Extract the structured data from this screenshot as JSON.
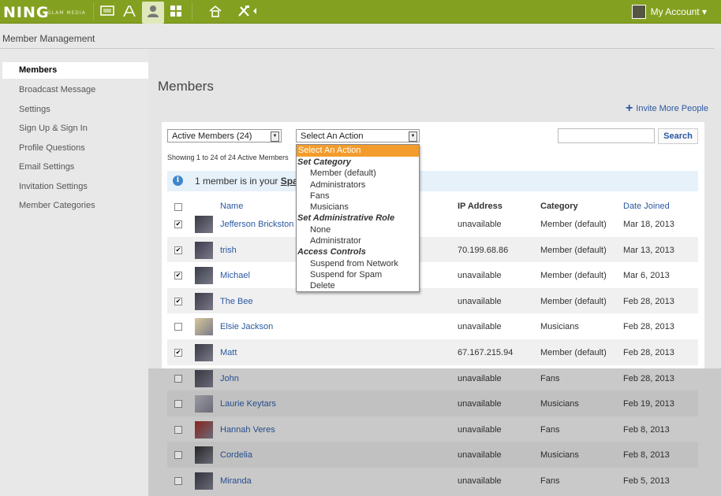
{
  "topbar": {
    "logo": "NING",
    "logo_sub": "GLAM MEDIA",
    "account_label": "My Account ▾"
  },
  "subheader": {
    "title": "Member Management"
  },
  "sidebar": {
    "items": [
      {
        "label": "Members"
      },
      {
        "label": "Broadcast Message"
      },
      {
        "label": "Settings"
      },
      {
        "label": "Sign Up & Sign In"
      },
      {
        "label": "Profile Questions"
      },
      {
        "label": "Email Settings"
      },
      {
        "label": "Invitation Settings"
      },
      {
        "label": "Member Categories"
      }
    ]
  },
  "main": {
    "title": "Members",
    "invite_label": "Invite More People",
    "filter_select": "Active Members (24)",
    "action_select": "Select An Action",
    "search_button": "Search",
    "showing": "Showing 1 to 24 of 24 Active Members",
    "info_text": "1 member is in your ",
    "info_link": "Spa"
  },
  "table": {
    "headers": {
      "name": "Name",
      "ip": "IP Address",
      "category": "Category",
      "date": "Date Joined"
    },
    "rows": [
      {
        "name": "Jefferson Brickston",
        "ip": "unavailable",
        "category": "Member (default)",
        "date": "Mar 18, 2013",
        "checked": true
      },
      {
        "name": "trish",
        "ip": "70.199.68.86",
        "category": "Member (default)",
        "date": "Mar 13, 2013",
        "checked": true
      },
      {
        "name": "Michael",
        "ip": "unavailable",
        "category": "Member (default)",
        "date": "Mar 6, 2013",
        "checked": true
      },
      {
        "name": "The Bee",
        "ip": "unavailable",
        "category": "Member (default)",
        "date": "Feb 28, 2013",
        "checked": true
      },
      {
        "name": "Elsie Jackson",
        "ip": "unavailable",
        "category": "Musicians",
        "date": "Feb 28, 2013",
        "checked": false
      },
      {
        "name": "Matt",
        "ip": "67.167.215.94",
        "category": "Member (default)",
        "date": "Feb 28, 2013",
        "checked": true
      },
      {
        "name": "John",
        "ip": "unavailable",
        "category": "Fans",
        "date": "Feb 28, 2013",
        "checked": false
      },
      {
        "name": "Laurie Keytars",
        "ip": "unavailable",
        "category": "Musicians",
        "date": "Feb 19, 2013",
        "checked": false
      },
      {
        "name": "Hannah Veres",
        "ip": "unavailable",
        "category": "Fans",
        "date": "Feb 8, 2013",
        "checked": false
      },
      {
        "name": "Cordelia",
        "ip": "unavailable",
        "category": "Musicians",
        "date": "Feb 8, 2013",
        "checked": false
      },
      {
        "name": "Miranda",
        "ip": "unavailable",
        "category": "Fans",
        "date": "Feb 5, 2013",
        "checked": false
      }
    ]
  },
  "dropdown": {
    "selected": "Select An Action",
    "groups": [
      {
        "label": "Set Category",
        "options": [
          "Member (default)",
          "Administrators",
          "Fans",
          "Musicians"
        ]
      },
      {
        "label": "Set Administrative Role",
        "options": [
          "None",
          "Administrator"
        ]
      },
      {
        "label": "Access Controls",
        "options": [
          "Suspend from Network",
          "Suspend for Spam",
          "Delete"
        ]
      }
    ]
  },
  "colors": {
    "topbar": "#84a020",
    "link": "#2b58a0",
    "highlight": "#f39c2c"
  }
}
